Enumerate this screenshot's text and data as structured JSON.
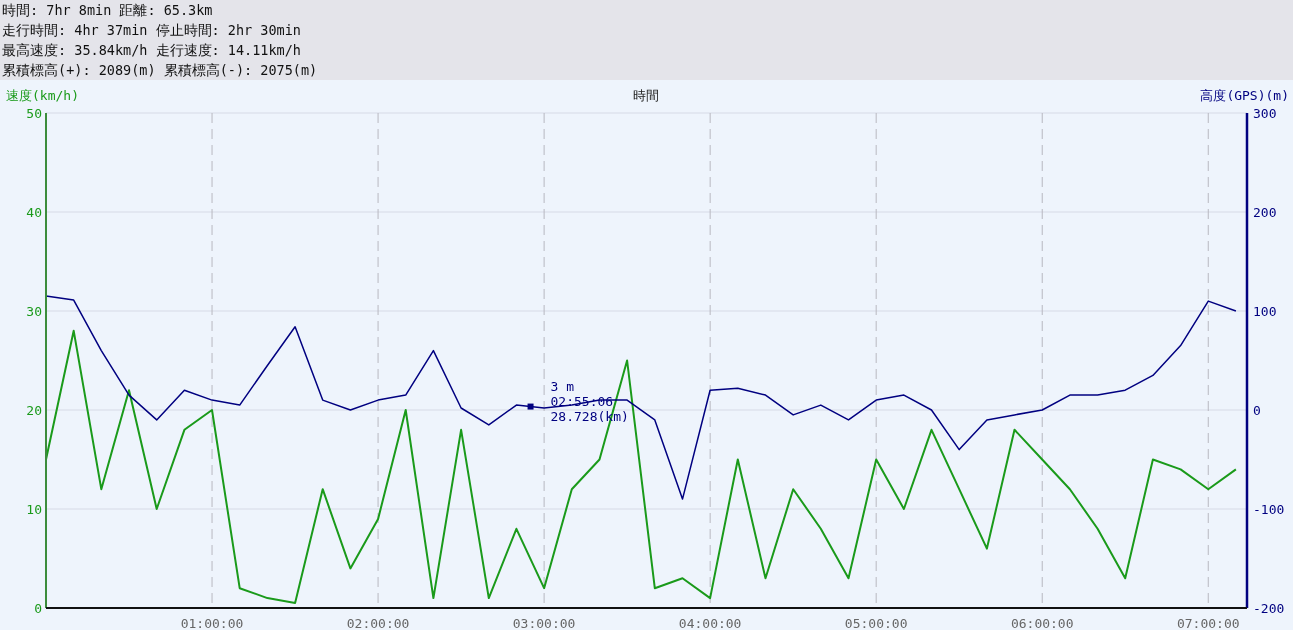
{
  "summary": {
    "lines": [
      "時間: 7hr 8min 距離: 65.3km",
      "走行時間: 4hr 37min 停止時間: 2hr 30min",
      "最高速度: 35.84km/h 走行速度: 14.11km/h",
      "累積標高(+): 2089(m) 累積標高(-): 2075(m)"
    ]
  },
  "chart": {
    "chart_data": {
      "type": "line",
      "grid": true,
      "xlabel": "時間",
      "ylabel": "速度(km/h)",
      "y2label": "高度(GPS)(m)",
      "x": [
        0,
        10,
        20,
        30,
        40,
        50,
        60,
        70,
        80,
        90,
        100,
        110,
        120,
        130,
        140,
        150,
        160,
        170,
        180,
        190,
        200,
        210,
        220,
        230,
        240,
        250,
        260,
        270,
        280,
        290,
        300,
        310,
        320,
        330,
        340,
        350,
        360,
        370,
        380,
        390,
        400,
        410,
        420,
        430
      ],
      "xlim": [
        0,
        434
      ],
      "ylim": [
        0,
        50
      ],
      "yticks": [
        0,
        10,
        20,
        30,
        40,
        50
      ],
      "y2lim": [
        -200,
        300
      ],
      "y2ticks": [
        -200,
        -100,
        0,
        100,
        200,
        300
      ],
      "xticks": [
        {
          "value": 60,
          "label": "01:00:00"
        },
        {
          "value": 120,
          "label": "02:00:00"
        },
        {
          "value": 180,
          "label": "03:00:00"
        },
        {
          "value": 240,
          "label": "04:00:00"
        },
        {
          "value": 300,
          "label": "05:00:00"
        },
        {
          "value": 360,
          "label": "06:00:00"
        },
        {
          "value": 420,
          "label": "07:00:00"
        }
      ],
      "series": [
        {
          "color": "#1a9a1a",
          "values": [
            15,
            28,
            12,
            22,
            10,
            18,
            20,
            2,
            1,
            0.5,
            12,
            4,
            9,
            20,
            1,
            18,
            1,
            8,
            2,
            12,
            15,
            25,
            2,
            3,
            1,
            15,
            3,
            12,
            8,
            3,
            15,
            10,
            18,
            12,
            6,
            18,
            15,
            12,
            8,
            3,
            15,
            14,
            12,
            14
          ]
        },
        {
          "axis": "y2",
          "color": "#000080",
          "values": [
            115,
            111,
            60,
            15,
            -10,
            20,
            10,
            5,
            45,
            84,
            10,
            0,
            10,
            15,
            60,
            2,
            -15,
            5,
            2,
            5,
            10,
            10,
            -10,
            -90,
            20,
            22,
            15,
            -5,
            5,
            -10,
            10,
            15,
            0,
            -40,
            -10,
            -5,
            0,
            15,
            15,
            20,
            35,
            65,
            110,
            100
          ]
        }
      ],
      "annotations": [
        {
          "text": [
            "3 m",
            "02:55:06",
            "28.728(km)"
          ]
        }
      ]
    }
  }
}
